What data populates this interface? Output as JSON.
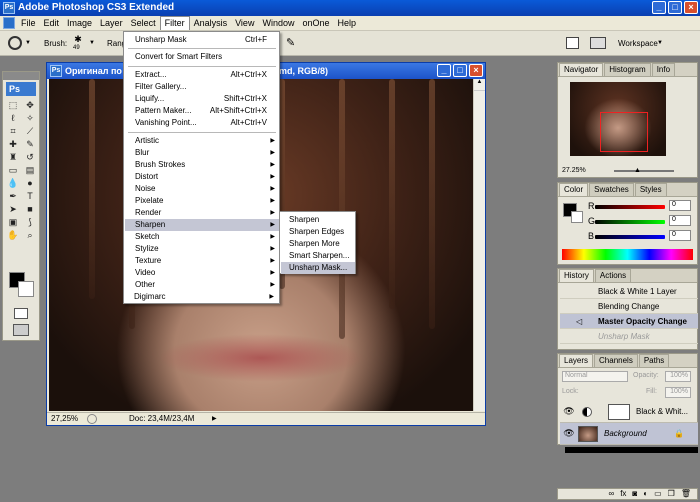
{
  "app": {
    "title": "Adobe Photoshop CS3 Extended",
    "logo": "Ps"
  },
  "menubar": [
    "File",
    "Edit",
    "Image",
    "Layer",
    "Select",
    "Filter",
    "Analysis",
    "View",
    "Window",
    "onOne",
    "Help"
  ],
  "options": {
    "brush_label": "Brush:",
    "brush_size": "49",
    "range_label": "Rang",
    "workspace_label": "Workspace"
  },
  "document": {
    "title": "Оригинал по... [cropped under menu] ...md, RGB/8)",
    "title_left": "Оригинал по",
    "title_right": "md, RGB/8)",
    "zoom": "27,25%",
    "doc_info": "Doc: 23,4M/23,4M"
  },
  "filter_menu": {
    "top": [
      {
        "label": "Unsharp Mask",
        "shortcut": "Ctrl+F"
      }
    ],
    "smart": [
      {
        "label": "Convert for Smart Filters"
      }
    ],
    "special": [
      {
        "label": "Extract...",
        "shortcut": "Alt+Ctrl+X"
      },
      {
        "label": "Filter Gallery..."
      },
      {
        "label": "Liquify...",
        "shortcut": "Shift+Ctrl+X"
      },
      {
        "label": "Pattern Maker...",
        "shortcut": "Alt+Shift+Ctrl+X"
      },
      {
        "label": "Vanishing Point...",
        "shortcut": "Alt+Ctrl+V"
      }
    ],
    "categories": [
      "Artistic",
      "Blur",
      "Brush Strokes",
      "Distort",
      "Noise",
      "Pixelate",
      "Render",
      "Sharpen",
      "Sketch",
      "Stylize",
      "Texture",
      "Video",
      "Other"
    ],
    "highlighted": "Sharpen",
    "extra": [
      "Digimarc"
    ]
  },
  "sharpen_submenu": {
    "items": [
      "Sharpen",
      "Sharpen Edges",
      "Sharpen More",
      "Smart Sharpen...",
      "Unsharp Mask..."
    ],
    "highlighted": "Unsharp Mask..."
  },
  "navigator": {
    "tabs": [
      "Navigator",
      "Histogram",
      "Info"
    ],
    "zoom": "27.25%"
  },
  "color_panel": {
    "tabs": [
      "Color",
      "Swatches",
      "Styles"
    ],
    "channels": [
      {
        "label": "R",
        "value": "0"
      },
      {
        "label": "G",
        "value": "0"
      },
      {
        "label": "B",
        "value": "0"
      }
    ]
  },
  "history_panel": {
    "tabs": [
      "History",
      "Actions"
    ],
    "items": [
      "Black & White 1 Layer",
      "Blending Change",
      "Master Opacity Change",
      "Unsharp Mask"
    ],
    "selected": "Master Opacity Change"
  },
  "layers_panel": {
    "tabs": [
      "Layers",
      "Channels",
      "Paths"
    ],
    "blend_mode": "Normal",
    "opacity_label": "Opacity:",
    "opacity": "100%",
    "lock_label": "Lock:",
    "fill_label": "Fill:",
    "fill": "100%",
    "layers": [
      {
        "name": "Black & Whit..."
      },
      {
        "name": "Background"
      }
    ]
  },
  "colors": {
    "titlebar": "#0a4fc9",
    "menu_highlight": "#c4c6d4"
  }
}
